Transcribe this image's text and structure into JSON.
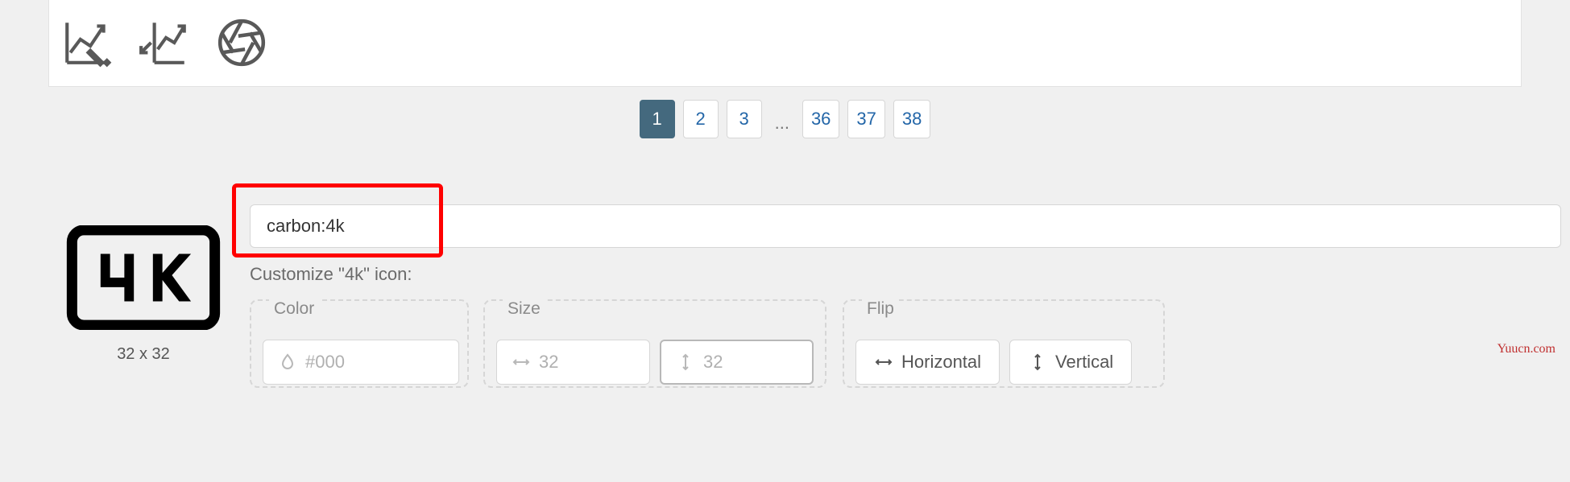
{
  "topIcons": [
    "chart-custom-icon",
    "chart-reference-icon",
    "aperture-icon"
  ],
  "pagination": {
    "pages": [
      "1",
      "2",
      "3"
    ],
    "ellipsis": "...",
    "tail": [
      "36",
      "37",
      "38"
    ],
    "active": "1"
  },
  "preview": {
    "dimensions": "32 x 32"
  },
  "iconName": "carbon:4k",
  "customizeLabel": "Customize \"4k\" icon:",
  "groups": {
    "color": {
      "label": "Color",
      "placeholder": "#000"
    },
    "size": {
      "label": "Size",
      "widthPlaceholder": "32",
      "heightPlaceholder": "32"
    },
    "flip": {
      "label": "Flip",
      "horizontal": "Horizontal",
      "vertical": "Vertical"
    }
  },
  "watermark": "Yuucn.com"
}
